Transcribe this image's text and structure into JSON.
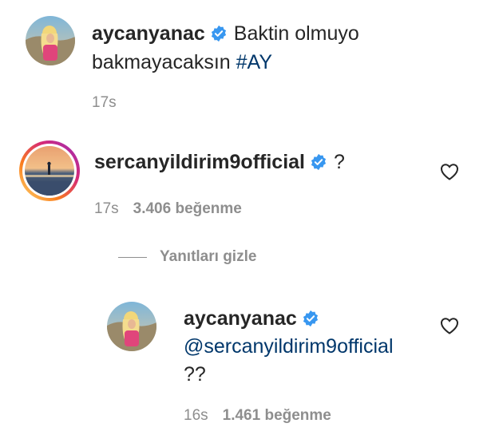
{
  "post": {
    "username": "aycanyanac",
    "caption_line1": "Baktin olmuyo",
    "caption_line2": "bakmayacaksın",
    "hashtag": "#AY",
    "time": "17s"
  },
  "comment": {
    "username": "sercanyildirim9official",
    "text": "?",
    "time": "17s",
    "likes": "3.406 beğenme"
  },
  "replies_toggle": {
    "label": "Yanıtları gizle"
  },
  "reply": {
    "username": "aycanyanac",
    "mention": "@sercanyildirim9official",
    "text": "??",
    "time": "16s",
    "likes": "1.461 beğenme"
  },
  "colors": {
    "verified_blue": "#3897f0",
    "link_blue": "#00376b",
    "muted_gray": "#8e8e8e"
  },
  "icons": {
    "verified": "verified-badge-icon",
    "like": "heart-icon"
  }
}
